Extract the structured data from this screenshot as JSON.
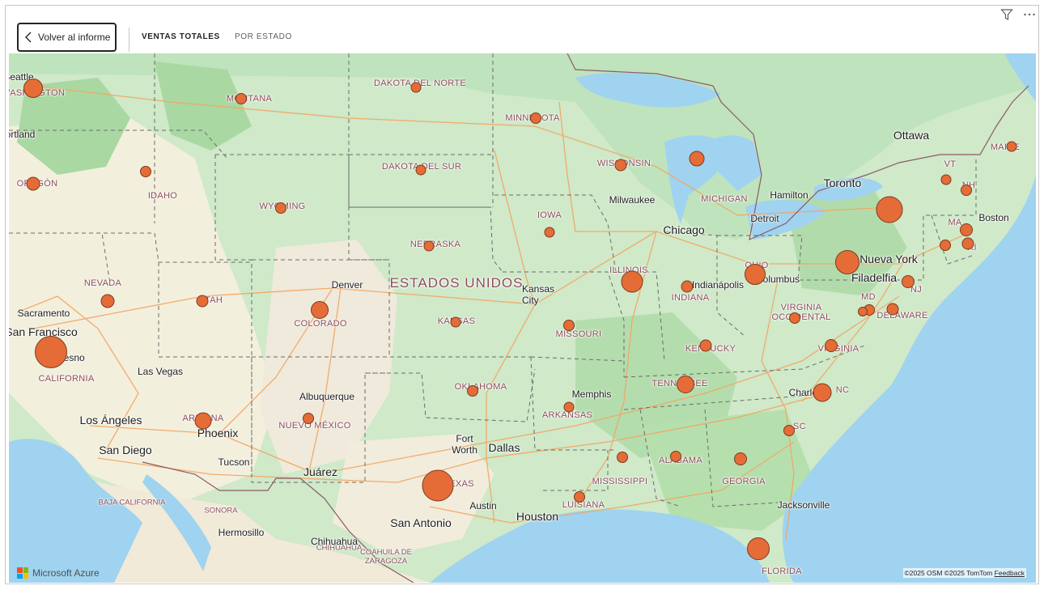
{
  "toolbar": {
    "back_label": "Volver al informe",
    "tabs": [
      {
        "label": "VENTAS TOTALES",
        "active": true
      },
      {
        "label": "POR ESTADO",
        "active": false
      }
    ],
    "filter_icon": "filter-icon",
    "more_icon": "more-options-icon"
  },
  "map": {
    "country_label": "ESTADOS UNIDOS",
    "bubble_color": "#e66c37",
    "state_labels": [
      "WASHINGTON",
      "MONTANA",
      "DAKOTA DEL NORTE",
      "MINNESOTA",
      "OREGÓN",
      "IDAHO",
      "WYOMING",
      "DAKOTA DEL SUR",
      "WISCONSIN",
      "MICHIGAN",
      "IOWA",
      "NEBRASKA",
      "NEVADA",
      "UTAH",
      "COLORADO",
      "KANSAS",
      "MISSOURI",
      "ILLINOIS",
      "INDIANA",
      "OHIO",
      "CALIFORNIA",
      "ARIZONA",
      "NUEVO MÉXICO",
      "OKLAHOMA",
      "ARKANSAS",
      "TENNESSEE",
      "KENTUCKY",
      "VIRGINIA OCCIDENTAL",
      "VIRGINIA",
      "DELAWARE",
      "MD",
      "NJ",
      "MA",
      "VT",
      "NH",
      "MAINE",
      "RI",
      "TEXAS",
      "LUISIANA",
      "MISSISSIPPI",
      "ALABAMA",
      "GEORGIA",
      "SC",
      "NC",
      "FLORIDA",
      "BAJA CALIFORNIA",
      "SONORA",
      "CHIHUAHUA",
      "COAHUILA DE ZARAGOZA"
    ],
    "city_labels": [
      "Seattle",
      "Portland",
      "Sacramento",
      "San Francisco",
      "Fresno",
      "Los Ángeles",
      "Las Vegas",
      "San Diego",
      "Phoenix",
      "Tucson",
      "Albuquerque",
      "Denver",
      "Kansas City",
      "Chicago",
      "Milwaukee",
      "Indianápolis",
      "Detroit",
      "Hamilton",
      "Toronto",
      "Ottawa",
      "Boston",
      "Nueva York",
      "Filadelfia",
      "Columbus",
      "Memphis",
      "Charlotte",
      "Dallas",
      "Fort Worth",
      "Austin",
      "San Antonio",
      "Houston",
      "Juárez",
      "Hermosillo",
      "Chihuahua",
      "Jacksonville"
    ],
    "brand": "Microsoft Azure",
    "attribution": "©2025 OSM  ©2025 TomTom",
    "feedback": "Feedback"
  },
  "chart_data": {
    "type": "bubble-map",
    "title": "",
    "metric": "Ventas totales",
    "points": [
      {
        "state": "Washington",
        "size": 3
      },
      {
        "state": "Montana",
        "size": 1
      },
      {
        "state": "Dakota del Norte",
        "size": 1
      },
      {
        "state": "Minnesota",
        "size": 1
      },
      {
        "state": "Oregón",
        "size": 2
      },
      {
        "state": "Idaho",
        "size": 1
      },
      {
        "state": "Wyoming",
        "size": 1
      },
      {
        "state": "Dakota del Sur",
        "size": 1
      },
      {
        "state": "Wisconsin",
        "size": 1
      },
      {
        "state": "Michigan",
        "size": 2
      },
      {
        "state": "Iowa",
        "size": 1
      },
      {
        "state": "Nebraska",
        "size": 1
      },
      {
        "state": "Nevada",
        "size": 2
      },
      {
        "state": "Utah",
        "size": 1
      },
      {
        "state": "Colorado",
        "size": 3
      },
      {
        "state": "Kansas",
        "size": 1
      },
      {
        "state": "Missouri",
        "size": 1
      },
      {
        "state": "Illinois",
        "size": 5
      },
      {
        "state": "Indiana",
        "size": 1
      },
      {
        "state": "Ohio",
        "size": 4
      },
      {
        "state": "California",
        "size": 10
      },
      {
        "state": "Arizona",
        "size": 3
      },
      {
        "state": "Nuevo México",
        "size": 1
      },
      {
        "state": "Oklahoma",
        "size": 1
      },
      {
        "state": "Arkansas",
        "size": 1
      },
      {
        "state": "Tennessee",
        "size": 3
      },
      {
        "state": "Kentucky",
        "size": 1
      },
      {
        "state": "Virginia Occidental",
        "size": 1
      },
      {
        "state": "Virginia",
        "size": 1
      },
      {
        "state": "Delaware",
        "size": 1
      },
      {
        "state": "Maryland",
        "size": 1
      },
      {
        "state": "District of Columbia",
        "size": 1
      },
      {
        "state": "New Jersey",
        "size": 1
      },
      {
        "state": "New York",
        "size": 7
      },
      {
        "state": "Pennsylvania",
        "size": 5
      },
      {
        "state": "Massachusetts",
        "size": 1
      },
      {
        "state": "Connecticut",
        "size": 1
      },
      {
        "state": "Rhode Island",
        "size": 1
      },
      {
        "state": "Vermont",
        "size": 1
      },
      {
        "state": "New Hampshire",
        "size": 1
      },
      {
        "state": "Maine",
        "size": 1
      },
      {
        "state": "North Carolina",
        "size": 3
      },
      {
        "state": "South Carolina",
        "size": 1
      },
      {
        "state": "Georgia",
        "size": 1
      },
      {
        "state": "Alabama",
        "size": 1
      },
      {
        "state": "Mississippi",
        "size": 1
      },
      {
        "state": "Luisiana",
        "size": 1
      },
      {
        "state": "Texas",
        "size": 10
      },
      {
        "state": "Florida",
        "size": 4
      }
    ]
  }
}
